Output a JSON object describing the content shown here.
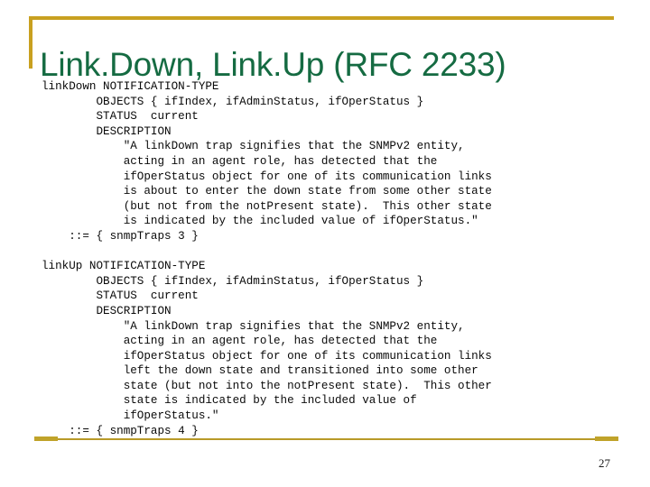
{
  "slide": {
    "title": "Link.Down, Link.Up (RFC 2233)",
    "page_number": "27",
    "accent_gold": "#c8a020",
    "title_green": "#156b42",
    "body_text_color": "#0a0a0a",
    "background": "#ffffff"
  },
  "code": {
    "blocks": [
      {
        "name": "linkDown",
        "lines": [
          "linkDown NOTIFICATION-TYPE",
          "        OBJECTS { ifIndex, ifAdminStatus, ifOperStatus }",
          "        STATUS  current",
          "        DESCRIPTION",
          "            \"A linkDown trap signifies that the SNMPv2 entity,",
          "            acting in an agent role, has detected that the",
          "            ifOperStatus object for one of its communication links",
          "            is about to enter the down state from some other state",
          "            (but not from the notPresent state).  This other state",
          "            is indicated by the included value of ifOperStatus.\"",
          "    ::= { snmpTraps 3 }"
        ]
      },
      {
        "name": "linkUp",
        "lines": [
          "linkUp NOTIFICATION-TYPE",
          "        OBJECTS { ifIndex, ifAdminStatus, ifOperStatus }",
          "        STATUS  current",
          "        DESCRIPTION",
          "            \"A linkDown trap signifies that the SNMPv2 entity,",
          "            acting in an agent role, has detected that the",
          "            ifOperStatus object for one of its communication links",
          "            left the down state and transitioned into some other",
          "            state (but not into the notPresent state).  This other",
          "            state is indicated by the included value of",
          "            ifOperStatus.\"",
          "    ::= { snmpTraps 4 }"
        ]
      }
    ]
  }
}
